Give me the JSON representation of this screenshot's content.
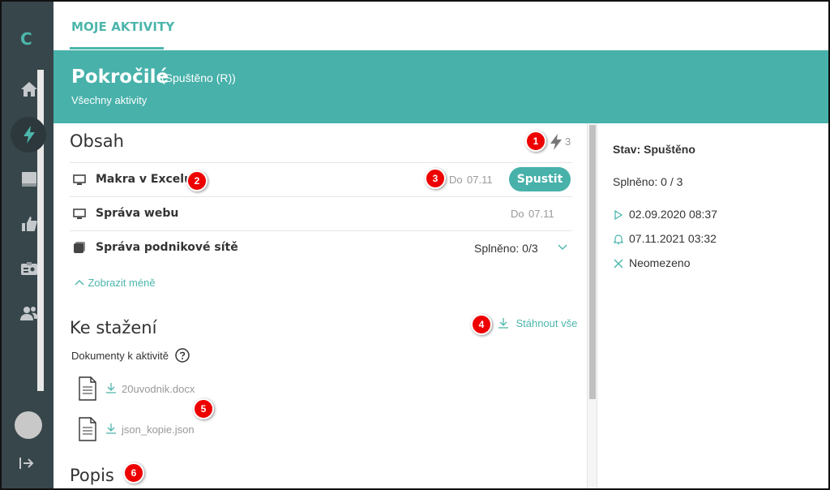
{
  "sidebar": {
    "logo": "C",
    "items": [
      {
        "name": "home-icon"
      },
      {
        "name": "lightning-icon",
        "active": true
      },
      {
        "name": "book-icon"
      },
      {
        "name": "thumbs-up-icon"
      },
      {
        "name": "id-card-icon"
      },
      {
        "name": "people-icon"
      }
    ]
  },
  "header": {
    "tab_label": "MOJE AKTIVITY"
  },
  "banner": {
    "title": "Pokročilé",
    "status": "(Spuštěno (R))",
    "subtitle": "Všechny aktivity"
  },
  "content": {
    "heading": "Obsah",
    "count": "3",
    "items": [
      {
        "label": "Makra v Excelu",
        "date_prefix": "Do",
        "date": "07.11",
        "button": "Spustit"
      },
      {
        "label": "Správa webu",
        "date_prefix": "Do",
        "date": "07.11"
      },
      {
        "label": "Správa podnikové sítě",
        "completed": "Splněno: 0/3"
      }
    ],
    "show_less": "Zobrazit méně"
  },
  "downloads": {
    "heading": "Ke stažení",
    "download_all": "Stáhnout vše",
    "docs_label": "Dokumenty k aktivitě",
    "files": [
      "20uvodnik.docx",
      "json_kopie.json"
    ]
  },
  "description": {
    "heading": "Popis"
  },
  "status_panel": {
    "state": "Stav: Spuštěno",
    "completed": "Splněno: 0 / 3",
    "start": "02.09.2020 08:37",
    "reminder": "07.11.2021 03:32",
    "limit": "Neomezeno"
  },
  "badges": [
    "1",
    "2",
    "3",
    "4",
    "5",
    "6"
  ],
  "colors": {
    "accent": "#47b1aa",
    "sidebar": "#37464b",
    "badge": "#e00000"
  }
}
